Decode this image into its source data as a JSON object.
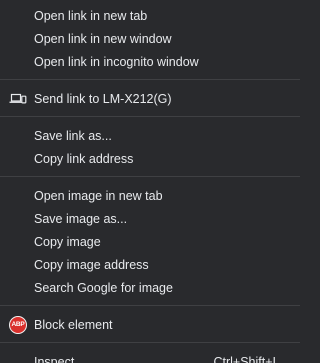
{
  "menu": {
    "open_link_new_tab": "Open link in new tab",
    "open_link_new_window": "Open link in new window",
    "open_link_incognito": "Open link in incognito window",
    "send_link_device": "Send link to LM-X212(G)",
    "save_link_as": "Save link as...",
    "copy_link_address": "Copy link address",
    "open_image_new_tab": "Open image in new tab",
    "save_image_as": "Save image as...",
    "copy_image": "Copy image",
    "copy_image_address": "Copy image address",
    "search_google_image": "Search Google for image",
    "block_element": "Block element",
    "abp_badge": "ABP",
    "inspect": "Inspect",
    "inspect_shortcut": "Ctrl+Shift+I"
  },
  "icons": {
    "send_device": "laptop-phone-icon",
    "block_element": "adblock-plus-icon"
  },
  "colors": {
    "background": "#292a2d",
    "text": "#e8eaed",
    "separator": "#3f4043",
    "abp_red": "#d9302c"
  }
}
